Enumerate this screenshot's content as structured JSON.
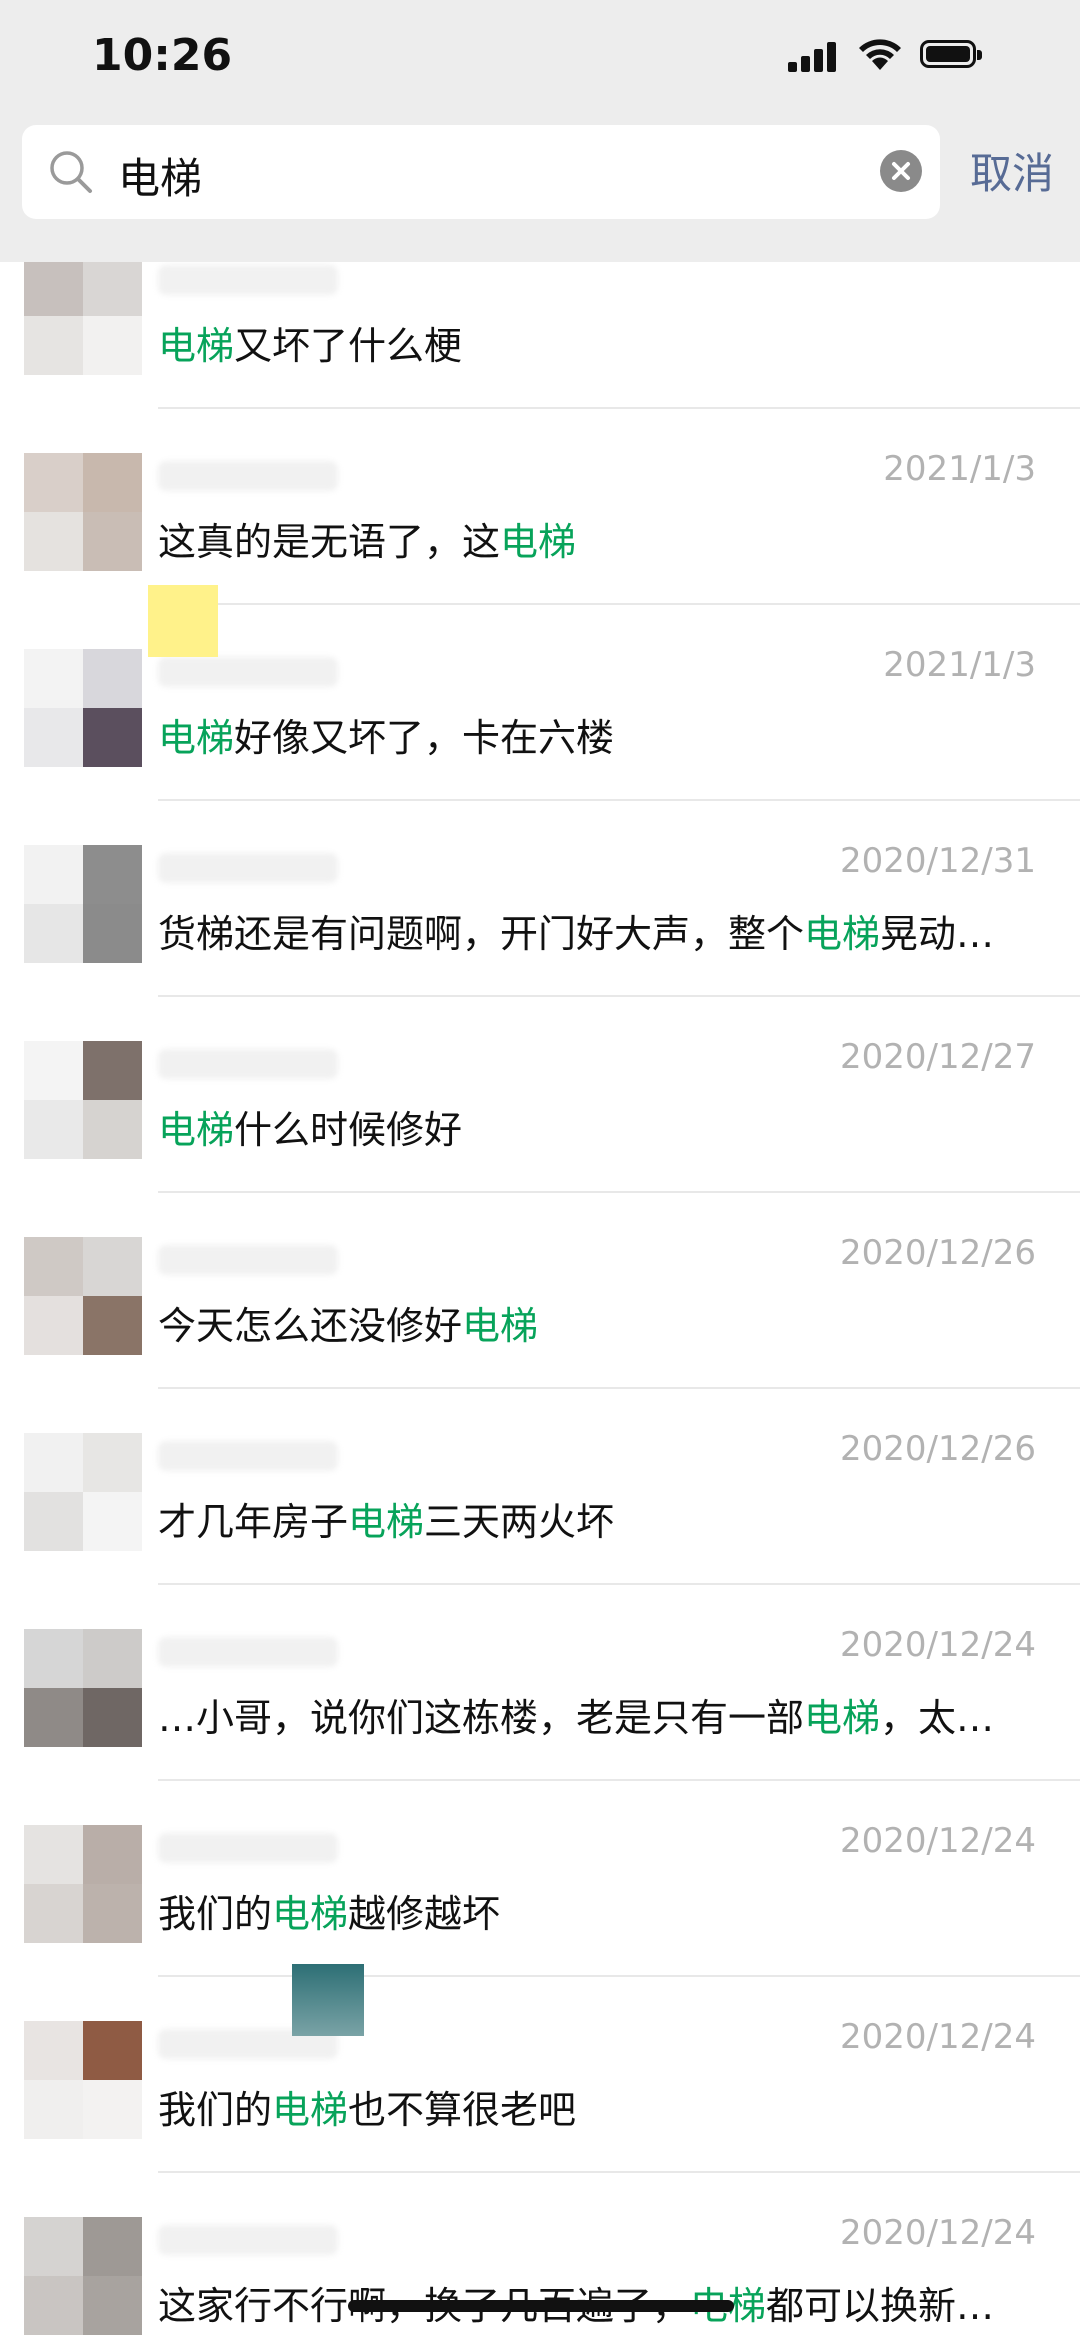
{
  "status_bar": {
    "time": "10:26"
  },
  "search": {
    "query": "电梯",
    "cancel_label": "取消"
  },
  "colors": {
    "highlight": "#07a35a",
    "date": "#b2b2b2",
    "cancel": "#576b95"
  },
  "results": [
    {
      "date": "",
      "parts": [
        {
          "t": "电梯",
          "h": true
        },
        {
          "t": "又坏了什么梗",
          "h": false
        }
      ]
    },
    {
      "date": "2021/1/3",
      "parts": [
        {
          "t": "这真的是无语了，这",
          "h": false
        },
        {
          "t": "电梯",
          "h": true
        }
      ]
    },
    {
      "date": "2021/1/3",
      "parts": [
        {
          "t": "电梯",
          "h": true
        },
        {
          "t": "好像又坏了，卡在六楼",
          "h": false
        }
      ]
    },
    {
      "date": "2020/12/31",
      "parts": [
        {
          "t": "货梯还是有问题啊，开门好大声，整个",
          "h": false
        },
        {
          "t": "电梯",
          "h": true
        },
        {
          "t": "晃动…",
          "h": false
        }
      ]
    },
    {
      "date": "2020/12/27",
      "parts": [
        {
          "t": "电梯",
          "h": true
        },
        {
          "t": "什么时候修好",
          "h": false
        }
      ]
    },
    {
      "date": "2020/12/26",
      "parts": [
        {
          "t": "今天怎么还没修好",
          "h": false
        },
        {
          "t": "电梯",
          "h": true
        }
      ]
    },
    {
      "date": "2020/12/26",
      "parts": [
        {
          "t": "才几年房子",
          "h": false
        },
        {
          "t": "电梯",
          "h": true
        },
        {
          "t": "三天两火坏",
          "h": false
        }
      ]
    },
    {
      "date": "2020/12/24",
      "parts": [
        {
          "t": "…小哥，说你们这栋楼，老是只有一部",
          "h": false
        },
        {
          "t": "电梯",
          "h": true
        },
        {
          "t": "，太…",
          "h": false
        }
      ]
    },
    {
      "date": "2020/12/24",
      "parts": [
        {
          "t": "我们的",
          "h": false
        },
        {
          "t": "电梯",
          "h": true
        },
        {
          "t": "越修越坏",
          "h": false
        }
      ]
    },
    {
      "date": "2020/12/24",
      "parts": [
        {
          "t": "我们的",
          "h": false
        },
        {
          "t": "电梯",
          "h": true
        },
        {
          "t": "也不算很老吧",
          "h": false
        }
      ]
    },
    {
      "date": "2020/12/24",
      "parts": [
        {
          "t": "这家行不行啊，换了几百遍了，",
          "h": false
        },
        {
          "t": "电梯",
          "h": true
        },
        {
          "t": "都可以换新…",
          "h": false
        }
      ]
    }
  ]
}
